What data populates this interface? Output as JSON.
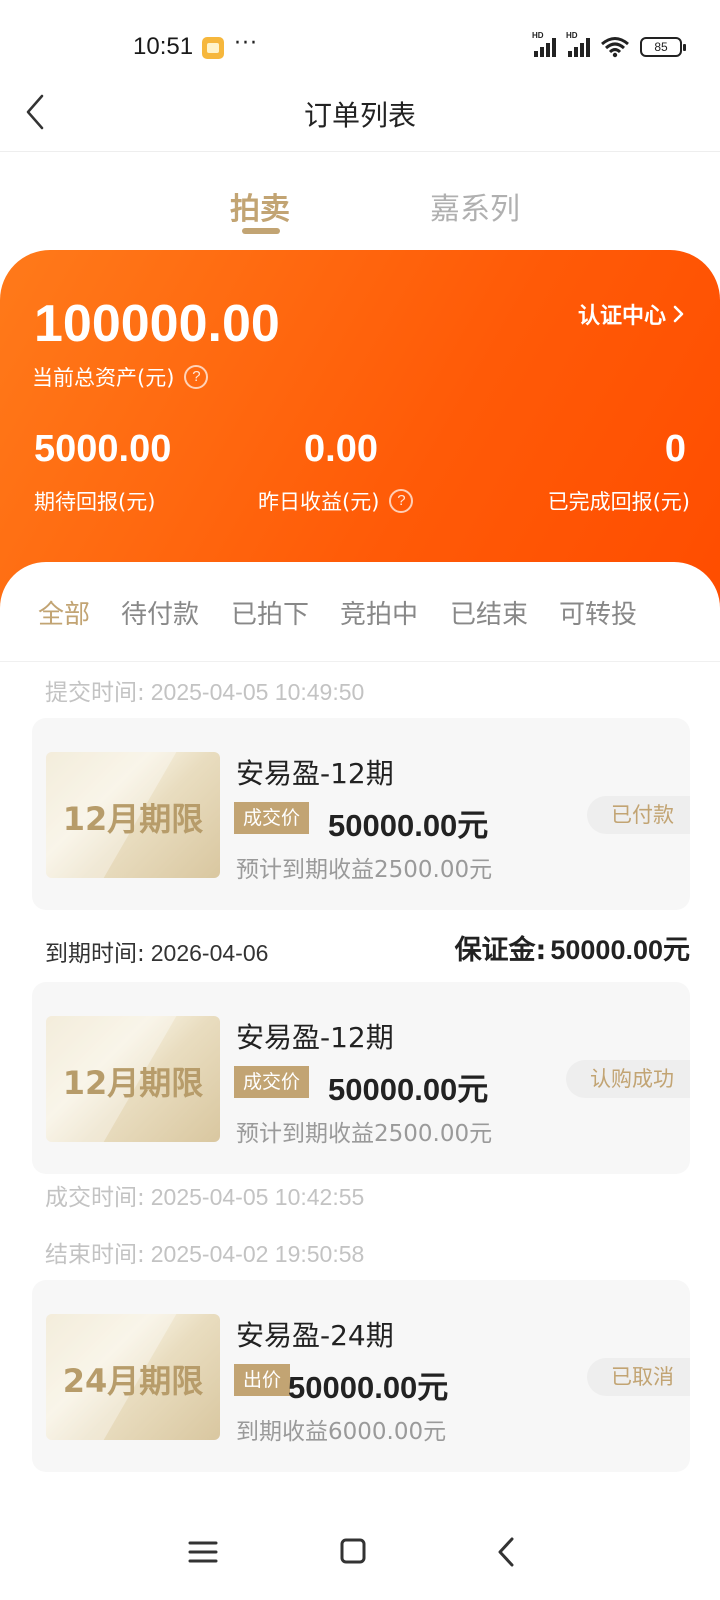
{
  "status_bar": {
    "time": "10:51",
    "dots": "···",
    "battery": "85",
    "hd": "HD"
  },
  "nav": {
    "title": "订单列表"
  },
  "top_tabs": {
    "active": "拍卖",
    "inactive": "嘉系列"
  },
  "summary": {
    "total_assets": "100000.00",
    "total_assets_label": "当前总资产(元)",
    "cert_center": "认证中心",
    "expected_return": "5000.00",
    "expected_return_label": "期待回报(元)",
    "yesterday_income": "0.00",
    "yesterday_income_label": "昨日收益(元)",
    "completed_return": "0",
    "completed_return_label": "已完成回报(元)"
  },
  "filters": [
    "全部",
    "待付款",
    "已拍下",
    "竞拍中",
    "已结束",
    "可转投"
  ],
  "orders": [
    {
      "time_label": "提交时间:",
      "time_value": "2025-04-05 10:49:50",
      "thumb": "12月期限",
      "name": "安易盈-12期",
      "tag": "成交价",
      "price": "50000.00元",
      "sub": "预计到期收益2500.00元",
      "status": "已付款"
    },
    {
      "thumb": "12月期限",
      "name": "安易盈-12期",
      "tag": "成交价",
      "price": "50000.00元",
      "sub": "预计到期收益2500.00元",
      "status": "认购成功",
      "after_label": "成交时间:",
      "after_value": "2025-04-05 10:42:55"
    },
    {
      "time_label": "结束时间:",
      "time_value": "2025-04-02 19:50:58",
      "thumb": "24月期限",
      "name": "安易盈-24期",
      "tag": "出价",
      "price": "50000.00元",
      "sub": "到期收益6000.00元",
      "status": "已取消"
    }
  ],
  "due": {
    "label": "到期时间:",
    "value": "2026-04-06"
  },
  "deposit": {
    "label": "保证金:",
    "value": "50000.00元"
  },
  "colors": {
    "accent": "#c2a473",
    "orange": "#ff5a07"
  }
}
